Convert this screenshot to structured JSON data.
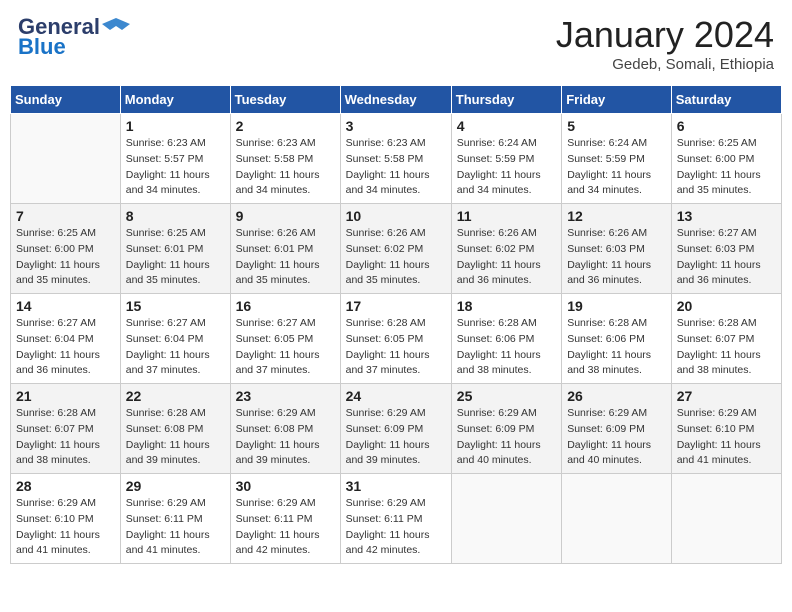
{
  "header": {
    "logo_line1": "General",
    "logo_line2": "Blue",
    "month_title": "January 2024",
    "subtitle": "Gedeb, Somali, Ethiopia"
  },
  "weekdays": [
    "Sunday",
    "Monday",
    "Tuesday",
    "Wednesday",
    "Thursday",
    "Friday",
    "Saturday"
  ],
  "weeks": [
    [
      {
        "day": "",
        "sunrise": "",
        "sunset": "",
        "daylight": ""
      },
      {
        "day": "1",
        "sunrise": "Sunrise: 6:23 AM",
        "sunset": "Sunset: 5:57 PM",
        "daylight": "Daylight: 11 hours and 34 minutes."
      },
      {
        "day": "2",
        "sunrise": "Sunrise: 6:23 AM",
        "sunset": "Sunset: 5:58 PM",
        "daylight": "Daylight: 11 hours and 34 minutes."
      },
      {
        "day": "3",
        "sunrise": "Sunrise: 6:23 AM",
        "sunset": "Sunset: 5:58 PM",
        "daylight": "Daylight: 11 hours and 34 minutes."
      },
      {
        "day": "4",
        "sunrise": "Sunrise: 6:24 AM",
        "sunset": "Sunset: 5:59 PM",
        "daylight": "Daylight: 11 hours and 34 minutes."
      },
      {
        "day": "5",
        "sunrise": "Sunrise: 6:24 AM",
        "sunset": "Sunset: 5:59 PM",
        "daylight": "Daylight: 11 hours and 34 minutes."
      },
      {
        "day": "6",
        "sunrise": "Sunrise: 6:25 AM",
        "sunset": "Sunset: 6:00 PM",
        "daylight": "Daylight: 11 hours and 35 minutes."
      }
    ],
    [
      {
        "day": "7",
        "sunrise": "Sunrise: 6:25 AM",
        "sunset": "Sunset: 6:00 PM",
        "daylight": "Daylight: 11 hours and 35 minutes."
      },
      {
        "day": "8",
        "sunrise": "Sunrise: 6:25 AM",
        "sunset": "Sunset: 6:01 PM",
        "daylight": "Daylight: 11 hours and 35 minutes."
      },
      {
        "day": "9",
        "sunrise": "Sunrise: 6:26 AM",
        "sunset": "Sunset: 6:01 PM",
        "daylight": "Daylight: 11 hours and 35 minutes."
      },
      {
        "day": "10",
        "sunrise": "Sunrise: 6:26 AM",
        "sunset": "Sunset: 6:02 PM",
        "daylight": "Daylight: 11 hours and 35 minutes."
      },
      {
        "day": "11",
        "sunrise": "Sunrise: 6:26 AM",
        "sunset": "Sunset: 6:02 PM",
        "daylight": "Daylight: 11 hours and 36 minutes."
      },
      {
        "day": "12",
        "sunrise": "Sunrise: 6:26 AM",
        "sunset": "Sunset: 6:03 PM",
        "daylight": "Daylight: 11 hours and 36 minutes."
      },
      {
        "day": "13",
        "sunrise": "Sunrise: 6:27 AM",
        "sunset": "Sunset: 6:03 PM",
        "daylight": "Daylight: 11 hours and 36 minutes."
      }
    ],
    [
      {
        "day": "14",
        "sunrise": "Sunrise: 6:27 AM",
        "sunset": "Sunset: 6:04 PM",
        "daylight": "Daylight: 11 hours and 36 minutes."
      },
      {
        "day": "15",
        "sunrise": "Sunrise: 6:27 AM",
        "sunset": "Sunset: 6:04 PM",
        "daylight": "Daylight: 11 hours and 37 minutes."
      },
      {
        "day": "16",
        "sunrise": "Sunrise: 6:27 AM",
        "sunset": "Sunset: 6:05 PM",
        "daylight": "Daylight: 11 hours and 37 minutes."
      },
      {
        "day": "17",
        "sunrise": "Sunrise: 6:28 AM",
        "sunset": "Sunset: 6:05 PM",
        "daylight": "Daylight: 11 hours and 37 minutes."
      },
      {
        "day": "18",
        "sunrise": "Sunrise: 6:28 AM",
        "sunset": "Sunset: 6:06 PM",
        "daylight": "Daylight: 11 hours and 38 minutes."
      },
      {
        "day": "19",
        "sunrise": "Sunrise: 6:28 AM",
        "sunset": "Sunset: 6:06 PM",
        "daylight": "Daylight: 11 hours and 38 minutes."
      },
      {
        "day": "20",
        "sunrise": "Sunrise: 6:28 AM",
        "sunset": "Sunset: 6:07 PM",
        "daylight": "Daylight: 11 hours and 38 minutes."
      }
    ],
    [
      {
        "day": "21",
        "sunrise": "Sunrise: 6:28 AM",
        "sunset": "Sunset: 6:07 PM",
        "daylight": "Daylight: 11 hours and 38 minutes."
      },
      {
        "day": "22",
        "sunrise": "Sunrise: 6:28 AM",
        "sunset": "Sunset: 6:08 PM",
        "daylight": "Daylight: 11 hours and 39 minutes."
      },
      {
        "day": "23",
        "sunrise": "Sunrise: 6:29 AM",
        "sunset": "Sunset: 6:08 PM",
        "daylight": "Daylight: 11 hours and 39 minutes."
      },
      {
        "day": "24",
        "sunrise": "Sunrise: 6:29 AM",
        "sunset": "Sunset: 6:09 PM",
        "daylight": "Daylight: 11 hours and 39 minutes."
      },
      {
        "day": "25",
        "sunrise": "Sunrise: 6:29 AM",
        "sunset": "Sunset: 6:09 PM",
        "daylight": "Daylight: 11 hours and 40 minutes."
      },
      {
        "day": "26",
        "sunrise": "Sunrise: 6:29 AM",
        "sunset": "Sunset: 6:09 PM",
        "daylight": "Daylight: 11 hours and 40 minutes."
      },
      {
        "day": "27",
        "sunrise": "Sunrise: 6:29 AM",
        "sunset": "Sunset: 6:10 PM",
        "daylight": "Daylight: 11 hours and 41 minutes."
      }
    ],
    [
      {
        "day": "28",
        "sunrise": "Sunrise: 6:29 AM",
        "sunset": "Sunset: 6:10 PM",
        "daylight": "Daylight: 11 hours and 41 minutes."
      },
      {
        "day": "29",
        "sunrise": "Sunrise: 6:29 AM",
        "sunset": "Sunset: 6:11 PM",
        "daylight": "Daylight: 11 hours and 41 minutes."
      },
      {
        "day": "30",
        "sunrise": "Sunrise: 6:29 AM",
        "sunset": "Sunset: 6:11 PM",
        "daylight": "Daylight: 11 hours and 42 minutes."
      },
      {
        "day": "31",
        "sunrise": "Sunrise: 6:29 AM",
        "sunset": "Sunset: 6:11 PM",
        "daylight": "Daylight: 11 hours and 42 minutes."
      },
      {
        "day": "",
        "sunrise": "",
        "sunset": "",
        "daylight": ""
      },
      {
        "day": "",
        "sunrise": "",
        "sunset": "",
        "daylight": ""
      },
      {
        "day": "",
        "sunrise": "",
        "sunset": "",
        "daylight": ""
      }
    ]
  ]
}
